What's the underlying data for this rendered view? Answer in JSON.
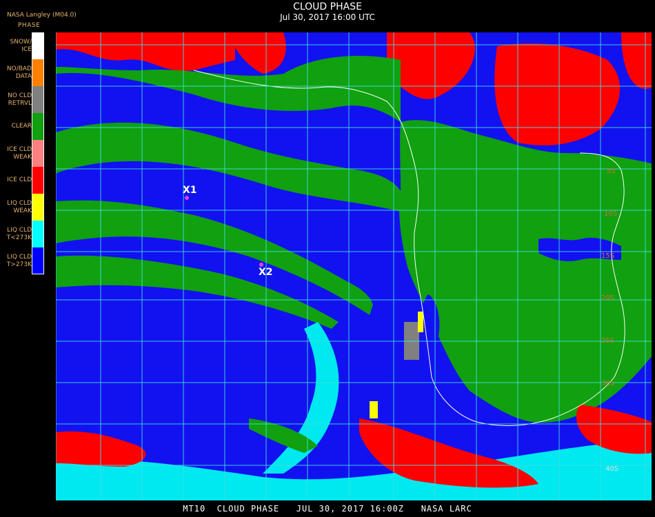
{
  "header": {
    "source": "NASA Langley (M04.0)",
    "title": "CLOUD PHASE",
    "subtitle": "Jul 30, 2017 16:00 UTC"
  },
  "legend": {
    "title": "PHASE",
    "items": [
      {
        "label": "SNOW/\nICE",
        "color": "#ffffff"
      },
      {
        "label": "NO/BAD\nDATA",
        "color": "#ff8000"
      },
      {
        "label": "NO CLD\nRETRVL",
        "color": "#808080"
      },
      {
        "label": "CLEAR",
        "color": "#10a010"
      },
      {
        "label": "ICE CLD\nWEAK",
        "color": "#ff8080"
      },
      {
        "label": "ICE CLD",
        "color": "#ff0000"
      },
      {
        "label": "LIQ CLD\nWEAK",
        "color": "#ffff00"
      },
      {
        "label": "LIQ CLD\nT<273K",
        "color": "#00ffff"
      },
      {
        "label": "LIQ CLD\nT>273K",
        "color": "#0000ff"
      }
    ]
  },
  "map": {
    "grid_color": "#40e0e0",
    "coast_color": "#ffffff",
    "markers": [
      {
        "label": "X1"
      },
      {
        "label": "X2"
      }
    ],
    "lat_labels": [
      "5S",
      "10S",
      "15S",
      "20S",
      "25S",
      "30S",
      "40S"
    ]
  },
  "footer": {
    "text": "MT10  CLOUD PHASE   JUL 30, 2017 16:00Z   NASA LARC"
  }
}
